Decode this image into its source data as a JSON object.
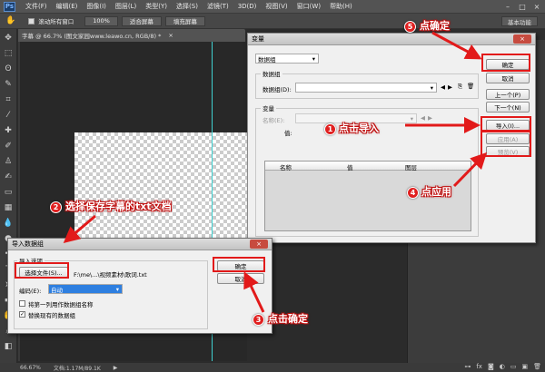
{
  "menubar": {
    "logo": "Ps",
    "items": [
      "文件(F)",
      "编辑(E)",
      "图像(I)",
      "图层(L)",
      "类型(Y)",
      "选择(S)",
      "滤镜(T)",
      "3D(D)",
      "视图(V)",
      "窗口(W)",
      "帮助(H)"
    ]
  },
  "options": {
    "scroll_all_label": "滚动所有窗口",
    "zoom_value": "100%",
    "fit_screen": "适合屏幕",
    "fill_screen": "填充屏幕",
    "workspace": "基本功能"
  },
  "document": {
    "tab_title": "字幕 @ 66.7% (图文家园www.leawo.cn, RGB/8) *",
    "tab_close": "×"
  },
  "status": {
    "zoom": "66.67%",
    "doc_info": "文档:1.17M/89.1K"
  },
  "var_dialog": {
    "title": "变量",
    "close": "×",
    "define_select": "数据组",
    "group_label": "数据组",
    "dataset_label": "数据组(D):",
    "var_group_label": "变量",
    "name_label": "名称(E):",
    "value_label": "值:",
    "table_headers": [
      "名称",
      "值",
      "图层"
    ],
    "buttons": {
      "ok": "确定",
      "cancel": "取消",
      "prev": "上一个(P)",
      "next": "下一个(N)",
      "import": "导入(I)...",
      "apply": "应用(A)",
      "preview": "预览(V)"
    }
  },
  "import_dialog": {
    "title": "导入数据组",
    "close": "×",
    "options_label": "导入选项",
    "choose_file": "选择文件(S)...",
    "file_path": "F:\\me\\...\\视频素材\\歌词.txt",
    "encoding_label": "编码(E):",
    "encoding_value": "自动",
    "first_column_label": "将第一列用作数据组名称",
    "replace_label": "替换现有的数据组",
    "ok": "确定",
    "cancel": "取消"
  },
  "annotations": [
    {
      "num": "1",
      "text": "点击导入"
    },
    {
      "num": "2",
      "text": "选择保存字幕的txt文档"
    },
    {
      "num": "3",
      "text": "点击确定"
    },
    {
      "num": "4",
      "text": "点应用"
    },
    {
      "num": "5",
      "text": "点确定"
    }
  ],
  "colors": {
    "accent_red": "#e21a1a",
    "guide_cyan": "#3fd0d0",
    "selection_blue": "#2e7fe0"
  }
}
